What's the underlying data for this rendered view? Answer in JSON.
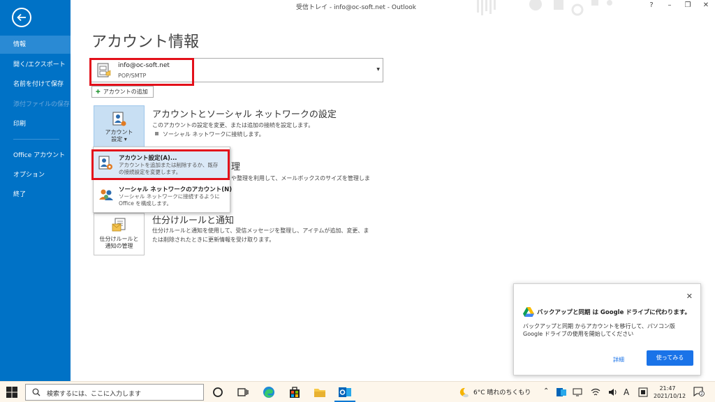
{
  "window": {
    "title": "受信トレイ - info@oc-soft.net - Outlook",
    "help": "?",
    "minimize": "–",
    "restore": "❐",
    "close": "✕"
  },
  "sidebar": {
    "items": [
      {
        "label": "情報"
      },
      {
        "label": "開く/エクスポート"
      },
      {
        "label": "名前を付けて保存"
      },
      {
        "label": "添付ファイルの保存"
      },
      {
        "label": "印刷"
      },
      {
        "label": "Office アカウント"
      },
      {
        "label": "オプション"
      },
      {
        "label": "終了"
      }
    ]
  },
  "main": {
    "title": "アカウント情報",
    "account": {
      "email": "info@oc-soft.net",
      "type": "POP/SMTP"
    },
    "add_account": "アカウントの追加",
    "account_settings_btn": {
      "line1": "アカウント",
      "line2": "設定 ▾"
    },
    "section1": {
      "title": "アカウントとソーシャル ネットワークの設定",
      "desc": "このアカウントの設定を変更、または追加の接続を設定します。",
      "bullet": "ソーシャル ネットワークに接続します。"
    },
    "section2_partial": {
      "title_tail": "理",
      "desc_tail": "や整理を利用して、メールボックスのサイズを管理しま"
    },
    "section3": {
      "btn_line1": "仕分けルールと",
      "btn_line2": "通知の管理",
      "title": "仕分けルールと通知",
      "desc_line1": "仕分けルールと通知を使用して、受信メッセージを整理し、アイテムが追加、変更、ま",
      "desc_line2": "たは削除されたときに更新情報を受け取ります。"
    }
  },
  "menu": {
    "items": [
      {
        "title": "アカウント設定(A)...",
        "desc1": "アカウントを追加または削除するか、既存",
        "desc2": "の接続設定を変更します。"
      },
      {
        "title": "ソーシャル ネットワークのアカウント(N)",
        "desc1": "ソーシャル ネットワークに接続するように",
        "desc2": "Office を構成します。"
      }
    ]
  },
  "toast": {
    "title": "バックアップと同期 は Google ドライブに代わります。",
    "body1": "バックアップと同期 からアカウントを移行して、パソコン版",
    "body2": "Google ドライブの使用を開始してください",
    "detail": "詳細",
    "try": "使ってみる",
    "close": "✕"
  },
  "taskbar": {
    "search_placeholder": "検索するには、ここに入力します",
    "weather": "6°C 晴れのちくもり",
    "ime": "A",
    "time": "21:47",
    "date": "2021/10/12",
    "notifications": "2"
  },
  "colors": {
    "sidebar": "#0072c6",
    "highlight": "#e3101a",
    "accent": "#1a73e8"
  }
}
